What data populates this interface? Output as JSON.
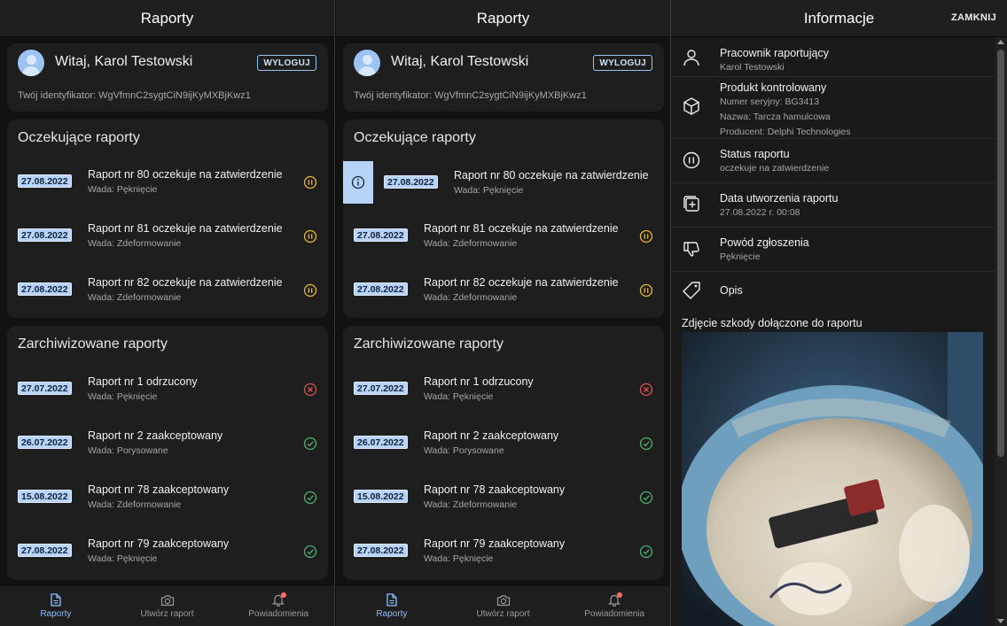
{
  "app": {
    "title": "Raporty",
    "greeting": "Witaj, Karol Testowski",
    "logout_label": "WYLOGUJ",
    "identifier": "Twój identyfikator: WgVfmnC2sygtCiN9ijKyMXBjKwz1",
    "pending_title": "Oczekujące raporty",
    "archive_title": "Zarchiwizowane raporty",
    "pending": [
      {
        "date": "27.08.2022",
        "title": "Raport nr 80 oczekuje na zatwierdzenie",
        "defect": "Wada: Pęknięcie",
        "status": "pending"
      },
      {
        "date": "27.08.2022",
        "title": "Raport nr 81 oczekuje na zatwierdzenie",
        "defect": "Wada: Zdeformowanie",
        "status": "pending"
      },
      {
        "date": "27.08.2022",
        "title": "Raport nr 82 oczekuje na zatwierdzenie",
        "defect": "Wada: Zdeformowanie",
        "status": "pending"
      }
    ],
    "archive": [
      {
        "date": "27.07.2022",
        "title": "Raport nr 1 odrzucony",
        "defect": "Wada: Pęknięcie",
        "status": "rejected"
      },
      {
        "date": "26.07.2022",
        "title": "Raport nr 2 zaakceptowany",
        "defect": "Wada: Porysowane",
        "status": "accepted"
      },
      {
        "date": "15.08.2022",
        "title": "Raport nr 78 zaakceptowany",
        "defect": "Wada: Zdeformowanie",
        "status": "accepted"
      },
      {
        "date": "27.08.2022",
        "title": "Raport nr 79 zaakceptowany",
        "defect": "Wada: Pęknięcie",
        "status": "accepted"
      }
    ],
    "nav": [
      {
        "label": "Raporty",
        "icon": "document-icon",
        "active": true
      },
      {
        "label": "Utwórz raport",
        "icon": "camera-icon",
        "active": false
      },
      {
        "label": "Powiadomienia",
        "icon": "bell-icon",
        "active": false
      }
    ]
  },
  "info": {
    "title": "Informacje",
    "close_label": "ZAMKNIJ",
    "worker_label": "Pracownik raportujący",
    "worker_value": "Karol Testowski",
    "product_label": "Produkt kontrolowany",
    "product_serial": "Numer seryjny: BG3413",
    "product_name": "Nazwa: Tarcza hamulcowa",
    "product_maker": "Producent: Delphi Technologies",
    "status_label": "Status raportu",
    "status_value": "oczekuje na zatwierdzenie",
    "date_label": "Data utworzenia raportu",
    "date_value": "27.08.2022 r. 00:08",
    "reason_label": "Powód zgłoszenia",
    "reason_value": "Pęknięcie",
    "desc_label": "Opis",
    "photo_label": "Zdjęcie szkody dołączone do raportu"
  },
  "colors": {
    "accent": "#8fbcf5",
    "date_badge": "#b7d3f7",
    "pending": "#e8b830",
    "rejected": "#d9534f",
    "accepted": "#4caf6e"
  }
}
